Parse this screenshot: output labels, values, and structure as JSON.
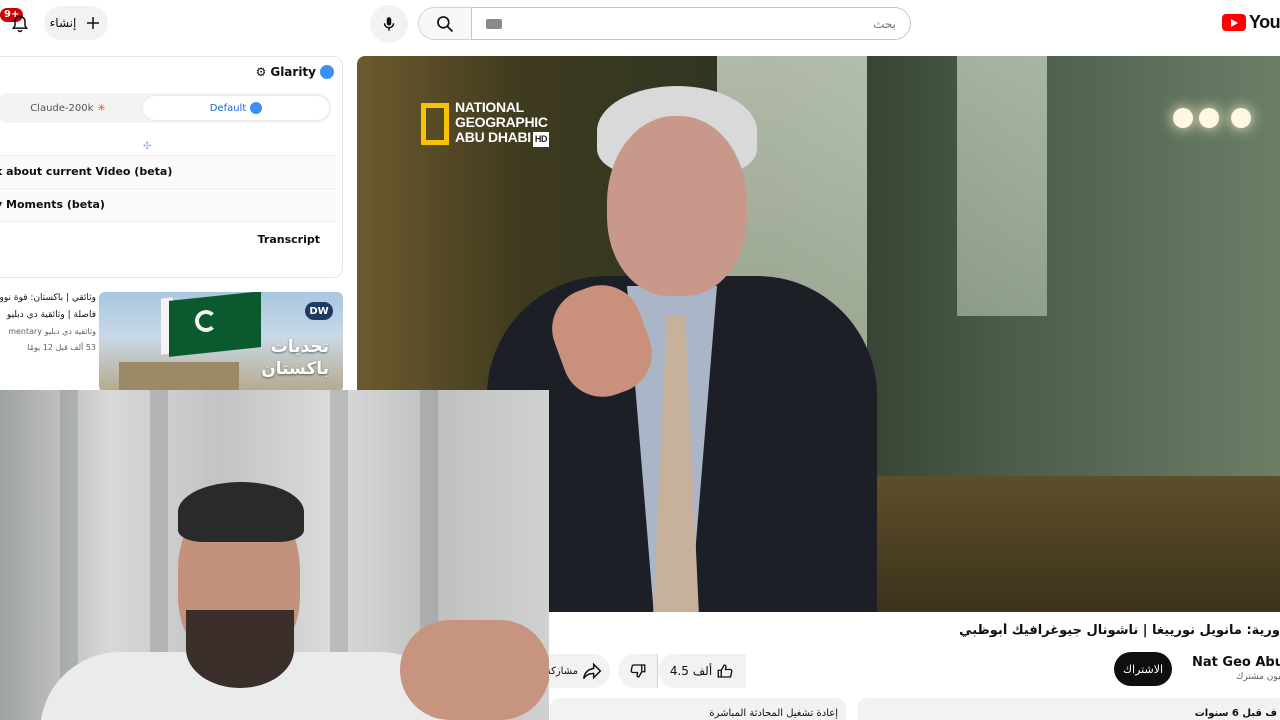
{
  "topbar": {
    "notification_badge": "9+",
    "create_label": "إنشاء",
    "search_placeholder": "بحث",
    "logo_text": "YouTube"
  },
  "glarity": {
    "title": "Glarity",
    "modes": [
      {
        "label": "Claude-200k"
      },
      {
        "label": "Default"
      }
    ],
    "rows": [
      "k about current Video (beta)",
      "y Moments (beta)",
      "Transcript"
    ]
  },
  "related": {
    "title_line1": "وثائقي | باكستان: قوة نوو",
    "title_line2": "فاصلة | وثائقية دي دبليو",
    "channel": "وثائقية دي دبليو mentary",
    "meta": "53 ألف  قبل 12 يومًا",
    "thumb_badge": "DW",
    "thumb_title_line1": "تحديات",
    "thumb_title_line2": "باكستان"
  },
  "video": {
    "overlay_line1": "NATIONAL",
    "overlay_line2": "GEOGRAPHIC",
    "overlay_line3": "ABU DHABI",
    "overlay_hd": "HD",
    "title": "ورية: مانويل نورييغا | ناشونال جيوغرافيك أبوظبي",
    "channel": "Nat Geo Abu Dl",
    "subscribers": "مليون مشترك",
    "subscribe_label": "الاشتراك",
    "likes": "4.5 ألف",
    "share_label": "مشاركة",
    "live_chat_label": "إعادة تشغيل المحادثة المباشرة",
    "description_meta": "ف  قبل 6 سنوات"
  },
  "colors": {
    "brand": "#ff0000",
    "glarity_accent": "#3b8ff6",
    "natgeo_yellow": "#f6c400"
  }
}
